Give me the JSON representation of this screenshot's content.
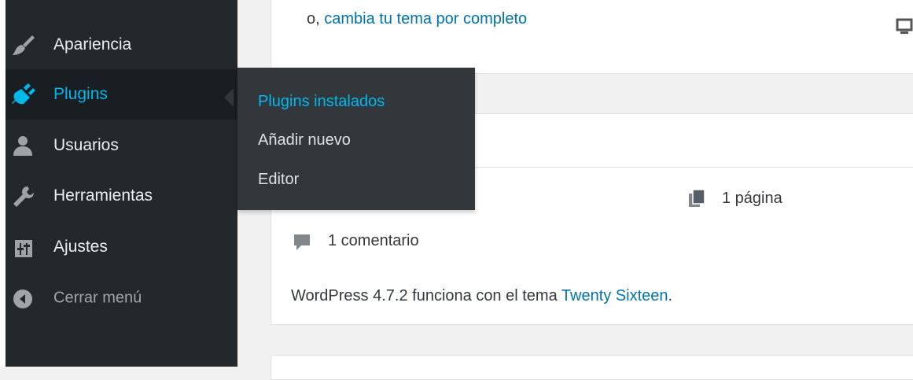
{
  "sidebar": {
    "items": [
      {
        "label": "Apariencia",
        "icon": "paintbrush-icon"
      },
      {
        "label": "Plugins",
        "icon": "plugin-icon",
        "active": true
      },
      {
        "label": "Usuarios",
        "icon": "users-icon"
      },
      {
        "label": "Herramientas",
        "icon": "wrench-icon"
      },
      {
        "label": "Ajustes",
        "icon": "settings-sliders-icon"
      }
    ],
    "collapse_label": "Cerrar menú"
  },
  "flyout": {
    "items": [
      "Plugins instalados",
      "Añadir nuevo",
      "Editor"
    ]
  },
  "main": {
    "top_card": {
      "prefix": "o, ",
      "link": "cambia tu tema por completo"
    },
    "glance": {
      "pages": "1 página",
      "comments": "1 comentario",
      "version_text": "WordPress 4.7.2 funciona con el tema ",
      "theme_link": "Twenty Sixteen",
      "version_suffix": "."
    }
  },
  "colors": {
    "sidebar_bg": "#23282d",
    "active_bg": "#191e23",
    "accent": "#00b9eb",
    "flyout_bg": "#32373c",
    "link": "#0073aa",
    "page_bg": "#f1f1f1"
  }
}
